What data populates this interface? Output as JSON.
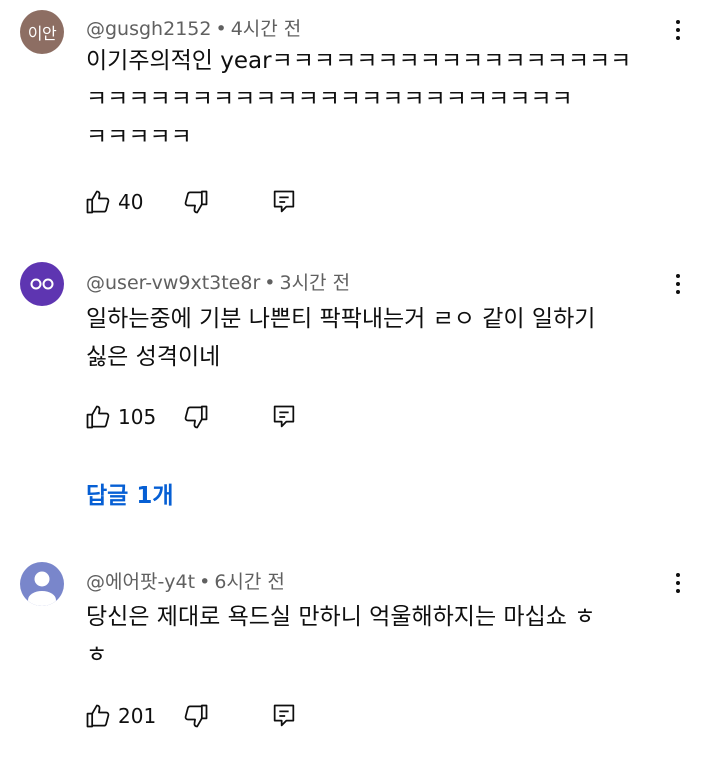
{
  "comments": [
    {
      "avatar_text": "이안",
      "avatar_color": "#8d6e63",
      "avatar_icon": "text-avatar",
      "username": "@gusgh2152",
      "separator": "•",
      "time": "4시간 전",
      "text": "이기주의적인 yearㅋㅋㅋㅋㅋㅋㅋㅋㅋㅋㅋㅋㅋㅋㅋㅋㅋ\nㅋㅋㅋㅋㅋㅋㅋㅋㅋㅋㅋㅋㅋㅋㅋㅋㅋㅋㅋㅋㅋㅋㅋ\nㅋㅋㅋㅋㅋ",
      "likes": "40"
    },
    {
      "avatar_color": "#5e35b1",
      "avatar_icon": "eyes-avatar-icon",
      "username": "@user-vw9xt3te8r",
      "separator": "•",
      "time": "3시간 전",
      "text": "일하는중에 기분 나쁜티 팍팍내는거 ㄹㅇ 같이 일하기\n싫은 성격이네",
      "likes": "105",
      "replies_label": "답글 1개"
    },
    {
      "avatar_color": "#7986cb",
      "avatar_icon": "default-person-avatar-icon",
      "username": "@에어팟-y4t",
      "separator": "•",
      "time": "6시간 전",
      "text": "당신은 제대로 욕드실 만하니 억울해하지는 마십쇼 ㅎ\nㅎ",
      "likes": "201"
    }
  ],
  "icons": {
    "like": "thumbs-up-icon",
    "dislike": "thumbs-down-icon",
    "reply": "reply-icon",
    "more": "more-vertical-icon"
  },
  "colors": {
    "link_blue": "#065fd4",
    "meta_gray": "#606060",
    "text": "#0f0f0f"
  }
}
